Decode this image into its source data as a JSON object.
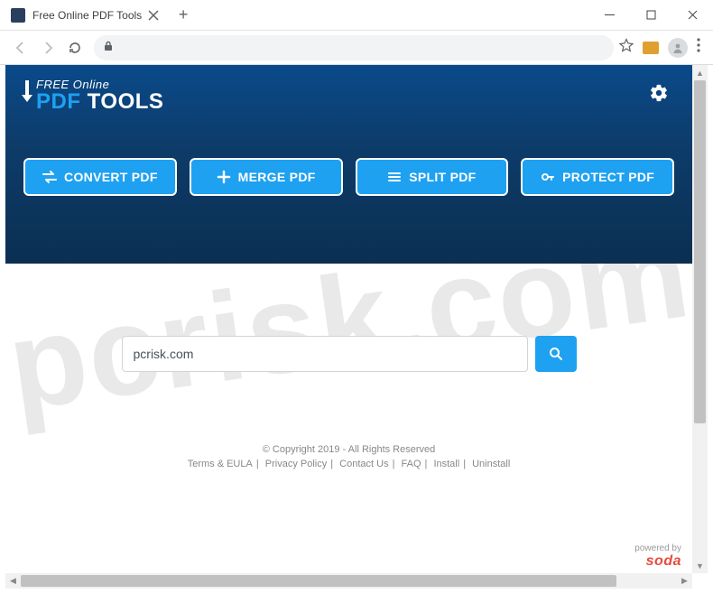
{
  "tab": {
    "title": "Free Online PDF Tools"
  },
  "logo": {
    "line1": "FREE Online",
    "pdf": "PDF",
    "tools": " TOOLS"
  },
  "actions": {
    "convert": "CONVERT PDF",
    "merge": "MERGE PDF",
    "split": "SPLIT PDF",
    "protect": "PROTECT PDF"
  },
  "search": {
    "value": "pcrisk.com"
  },
  "footer": {
    "copyright": "© Copyright 2019 - All Rights Reserved",
    "links": {
      "terms": "Terms & EULA",
      "privacy": "Privacy Policy",
      "contact": "Contact Us",
      "faq": "FAQ",
      "install": "Install",
      "uninstall": "Uninstall"
    }
  },
  "powered": {
    "label": "powered by",
    "brand": "soda"
  },
  "watermark": "pcrisk.com"
}
